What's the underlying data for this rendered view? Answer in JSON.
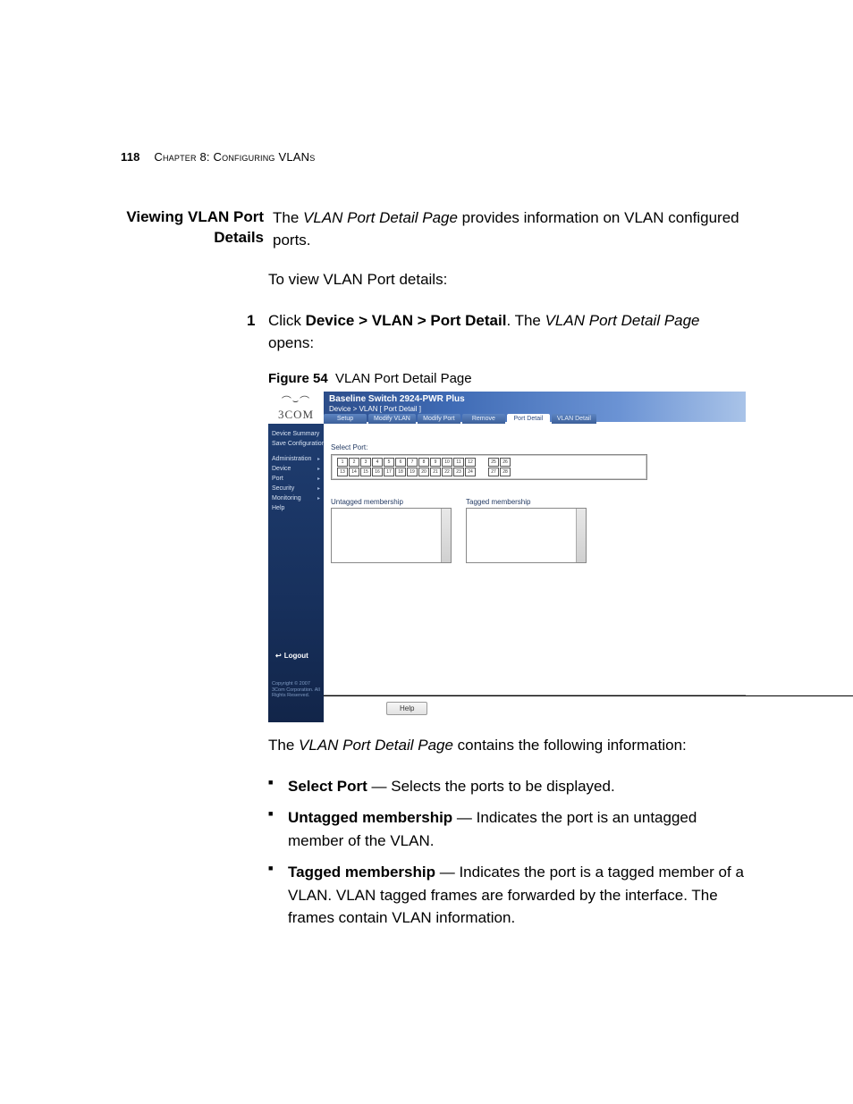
{
  "page": {
    "number": "118",
    "chapter_line": "Chapter 8: Configuring VLANs"
  },
  "section": {
    "side_heading_l1": "Viewing VLAN Port",
    "side_heading_l2": "Details",
    "intro_pre": "The ",
    "intro_em": "VLAN Port Detail Page",
    "intro_post": " provides information on VLAN configured ports.",
    "lead_in": "To view VLAN Port details:",
    "step_num": "1",
    "step_pre": "Click ",
    "step_bold": "Device > VLAN > Port Detail",
    "step_mid": ". The ",
    "step_em": "VLAN Port Detail Page",
    "step_post": " opens:"
  },
  "figure": {
    "label": "Figure 54",
    "caption": "VLAN Port Detail Page"
  },
  "screenshot": {
    "brand": "3COM",
    "product": "Baseline Switch 2924-PWR Plus",
    "breadcrumb": "Device > VLAN [ Port Detail ]",
    "tabs": [
      "Setup",
      "Modify VLAN",
      "Modify Port",
      "Remove",
      "Port Detail",
      "VLAN Detail"
    ],
    "active_tab_index": 4,
    "sidebar": {
      "top": [
        "Device Summary",
        "Save Configuration"
      ],
      "main": [
        "Administration",
        "Device",
        "Port",
        "Security",
        "Monitoring",
        "Help"
      ],
      "logout": "Logout",
      "copyright": "Copyright © 2007\n3Com Corporation.\nAll Rights Reserved."
    },
    "select_port_label": "Select Port:",
    "ports_top": [
      "1",
      "2",
      "3",
      "4",
      "5",
      "6",
      "7",
      "8",
      "9",
      "10",
      "11",
      "12"
    ],
    "ports_bottom": [
      "13",
      "14",
      "15",
      "16",
      "17",
      "18",
      "19",
      "20",
      "21",
      "22",
      "23",
      "24"
    ],
    "ports_extra": [
      "25",
      "26",
      "27",
      "28"
    ],
    "untagged_label": "Untagged membership",
    "tagged_label": "Tagged membership",
    "help_button": "Help"
  },
  "after_figure": {
    "para_pre": "The ",
    "para_em": "VLAN Port Detail Page",
    "para_post": " contains the following information:",
    "bullets": [
      {
        "term": "Select Port",
        "desc": " — Selects the ports to be displayed."
      },
      {
        "term": "Untagged membership",
        "desc": " — Indicates the port is an untagged member of the VLAN."
      },
      {
        "term": "Tagged membership",
        "desc": " — Indicates the port is a tagged member of a VLAN. VLAN tagged frames are forwarded by the interface. The frames contain VLAN information."
      }
    ]
  }
}
